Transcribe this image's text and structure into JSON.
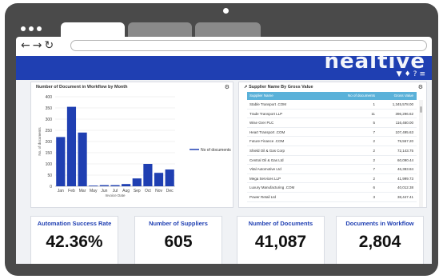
{
  "chart_panel": {
    "title": "Number of Document in Workflow by Month",
    "gear_icon": "gear-icon"
  },
  "chart_data": {
    "type": "bar",
    "title": "Number of Document in Workflow by Month",
    "categories": [
      "Jan",
      "Feb",
      "Mar",
      "May",
      "Jun",
      "Jul",
      "Aug",
      "Sep",
      "Oct",
      "Nov",
      "Dec"
    ],
    "series": [
      {
        "name": "No of documents",
        "values": [
          220,
          355,
          240,
          3,
          5,
          5,
          10,
          35,
          100,
          60,
          75
        ],
        "color": "#1f3fb2"
      }
    ],
    "xlabel": "Invoice Date",
    "ylabel": "No. of documents",
    "ylim": [
      0,
      400
    ],
    "yticks": [
      0,
      50,
      100,
      150,
      200,
      250,
      300,
      350,
      400
    ],
    "grid": true,
    "legend": "right"
  },
  "table_panel": {
    "title": "Supplier Name By Gross Value",
    "headers": [
      "Supplier Name",
      "No of documents",
      "Gross Value"
    ],
    "rows": [
      [
        "Stable Transport .COM",
        "1",
        "1,345,578.00"
      ],
      [
        "Trade Transport LLP",
        "11",
        "396,296.62"
      ],
      [
        "Wise Grer PLC",
        "5",
        "116,460.00"
      ],
      [
        "Heart Transport .COM",
        "7",
        "107,495.63"
      ],
      [
        "Future Finance .COM",
        "2",
        "79,557.20"
      ],
      [
        "Shield Oil & Gas Corp",
        "2",
        "72,143.75"
      ],
      [
        "Central Oil & Gas Ltd",
        "2",
        "60,090.44"
      ],
      [
        "Vital Automotive Ltd",
        "7",
        "46,383.84"
      ],
      [
        "Mega Services LLP",
        "2",
        "41,999.73"
      ],
      [
        "Luxury Manufacturing .COM",
        "6",
        "40,012.38"
      ],
      [
        "Power Retail Ltd",
        "3",
        "38,447.41"
      ]
    ]
  },
  "kpis": [
    {
      "label": "Automation Success Rate",
      "value": "42.36%"
    },
    {
      "label": "Number of Suppliers",
      "value": "605"
    },
    {
      "label": "Number of Documents",
      "value": "41,087"
    },
    {
      "label": "Documents in Workflow",
      "value": "2,804"
    }
  ],
  "header": {
    "brand": "nealtive",
    "icons": [
      "filter-icon",
      "bell-icon",
      "help-icon",
      "menu-icon"
    ]
  },
  "browser": {
    "nav_icons": [
      "back-arrow-icon",
      "forward-arrow-icon",
      "reload-icon"
    ]
  },
  "colors": {
    "accent": "#1f3fb2",
    "table_header": "#5ab1d9",
    "device_frame": "#4a4a4a"
  }
}
